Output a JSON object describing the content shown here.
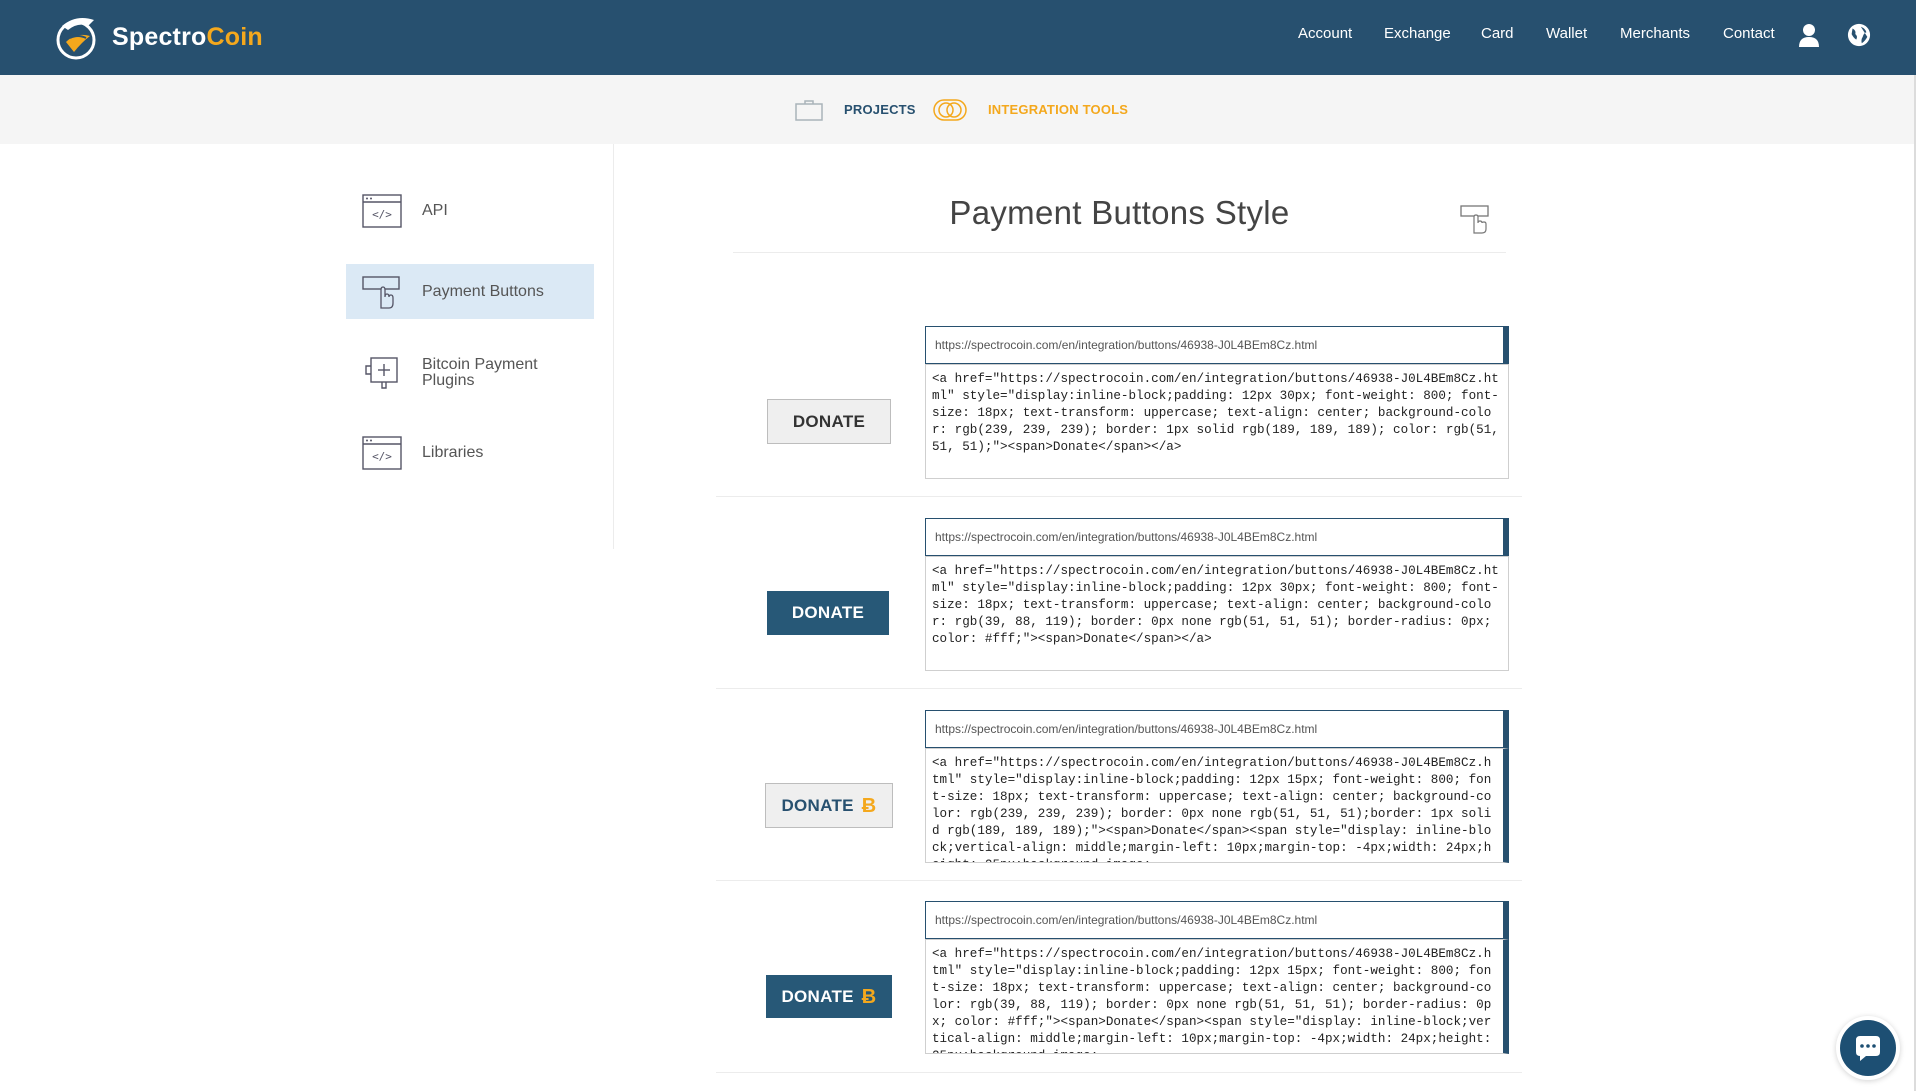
{
  "brand": {
    "name_part1": "Spectro",
    "name_part2": "Coin",
    "logo_icon": "spectrocoin-logo-icon",
    "accent_color": "#f4a81d",
    "primary_color": "#27506f"
  },
  "nav": {
    "links": [
      "Account",
      "Exchange",
      "Card",
      "Wallet",
      "Merchants",
      "Contact"
    ],
    "user_icon": "user-icon",
    "language_icon": "globe-icon"
  },
  "subnav": {
    "projects": "PROJECTS",
    "integration_tools": "INTEGRATION TOOLS"
  },
  "sidebar": {
    "items": [
      {
        "label": "API",
        "icon": "code-window-icon"
      },
      {
        "label": "Payment Buttons",
        "icon": "pointer-button-icon",
        "active": true
      },
      {
        "label": "Bitcoin Payment Plugins",
        "icon": "plugin-icon"
      },
      {
        "label": "Libraries",
        "icon": "code-window-icon"
      }
    ]
  },
  "main": {
    "title": "Payment Buttons Style",
    "buttons": [
      {
        "label": "Donate",
        "style": "light",
        "coin": false,
        "url": "https://spectrocoin.com/en/integration/buttons/46938-J0L4BEm8Cz.html",
        "code": "<a href=\"https://spectrocoin.com/en/integration/buttons/46938-J0L4BEm8Cz.html\" style=\"display:inline-block;padding: 12px 30px; font-weight: 800; font-size: 18px; text-transform: uppercase; text-align: center; background-color: rgb(239, 239, 239); border: 1px solid rgb(189, 189, 189); color: rgb(51, 51, 51);\"><span>Donate</span></a>"
      },
      {
        "label": "Donate",
        "style": "dark",
        "coin": false,
        "url": "https://spectrocoin.com/en/integration/buttons/46938-J0L4BEm8Cz.html",
        "code": "<a href=\"https://spectrocoin.com/en/integration/buttons/46938-J0L4BEm8Cz.html\" style=\"display:inline-block;padding: 12px 30px; font-weight: 800; font-size: 18px; text-transform: uppercase; text-align: center; background-color: rgb(39, 88, 119); border: 0px none rgb(51, 51, 51); border-radius: 0px; color: #fff;\"><span>Donate</span></a>"
      },
      {
        "label": "Donate",
        "style": "light",
        "coin": true,
        "url": "https://spectrocoin.com/en/integration/buttons/46938-J0L4BEm8Cz.html",
        "code": "<a href=\"https://spectrocoin.com/en/integration/buttons/46938-J0L4BEm8Cz.html\" style=\"display:inline-block;padding: 12px 15px; font-weight: 800; font-size: 18px; text-transform: uppercase; text-align: center; background-color: rgb(239, 239, 239); border: 0px none rgb(51, 51, 51);border: 1px solid rgb(189, 189, 189);\"><span>Donate</span><span style=\"display: inline-block;vertical-align: middle;margin-left: 10px;margin-top: -4px;width: 24px;height: 25px;background-image:"
      },
      {
        "label": "Donate",
        "style": "dark",
        "coin": true,
        "url": "https://spectrocoin.com/en/integration/buttons/46938-J0L4BEm8Cz.html",
        "code": "<a href=\"https://spectrocoin.com/en/integration/buttons/46938-J0L4BEm8Cz.html\" style=\"display:inline-block;padding: 12px 15px; font-weight: 800; font-size: 18px; text-transform: uppercase; text-align: center; background-color: rgb(39, 88, 119); border: 0px none rgb(51, 51, 51); border-radius: 0px; color: #fff;\"><span>Donate</span><span style=\"display: inline-block;vertical-align: middle;margin-left: 10px;margin-top: -4px;width: 24px;height: 25px;background-image:"
      }
    ],
    "coin_icon": "bitcoin-icon",
    "coin_glyph": "Ƀ"
  },
  "chat": {
    "icon": "chat-bubble-icon"
  }
}
